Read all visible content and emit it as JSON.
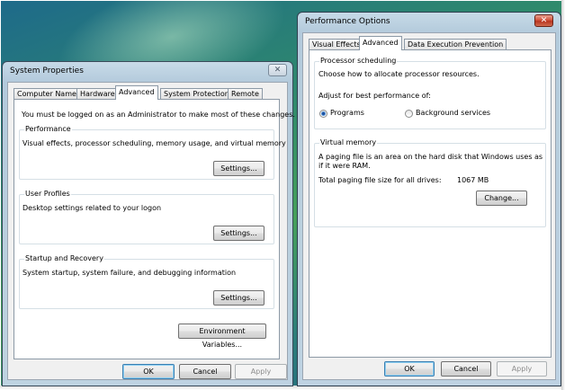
{
  "system_properties": {
    "title": "System Properties",
    "close_glyph": "✕",
    "tabs": [
      "Computer Name",
      "Hardware",
      "Advanced",
      "System Protection",
      "Remote"
    ],
    "active_tab": "Advanced",
    "admin_notice": "You must be logged on as an Administrator to make most of these changes.",
    "performance": {
      "label": "Performance",
      "description": "Visual effects, processor scheduling, memory usage, and virtual memory",
      "button": "Settings..."
    },
    "user_profiles": {
      "label": "User Profiles",
      "description": "Desktop settings related to your logon",
      "button": "Settings..."
    },
    "startup_recovery": {
      "label": "Startup and Recovery",
      "description": "System startup, system failure, and debugging information",
      "button": "Settings..."
    },
    "env_button": "Environment Variables...",
    "ok": "OK",
    "cancel": "Cancel",
    "apply": "Apply"
  },
  "performance_options": {
    "title": "Performance Options",
    "close_glyph": "✕",
    "tabs": [
      "Visual Effects",
      "Advanced",
      "Data Execution Prevention"
    ],
    "active_tab": "Advanced",
    "processor_scheduling": {
      "label": "Processor scheduling",
      "description": "Choose how to allocate processor resources.",
      "adjust_label": "Adjust for best performance of:",
      "options": [
        "Programs",
        "Background services"
      ],
      "selected": "Programs"
    },
    "virtual_memory": {
      "label": "Virtual memory",
      "description_line1": "A paging file is an area on the hard disk that Windows uses as",
      "description_line2": "if it were RAM.",
      "total_label": "Total paging file size for all drives:",
      "total_value": "1067 MB",
      "change_button": "Change..."
    },
    "ok": "OK",
    "cancel": "Cancel",
    "apply": "Apply"
  },
  "colors": {
    "close_red": "#c8442c",
    "default_button_border": "#3c7fb1"
  }
}
